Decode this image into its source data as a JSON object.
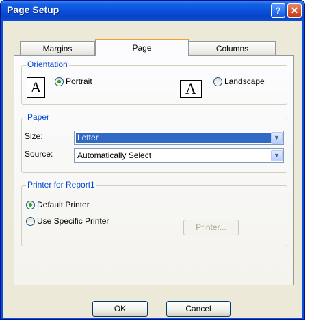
{
  "window": {
    "title": "Page Setup",
    "help_glyph": "?",
    "close_glyph": "✕"
  },
  "tabs": [
    {
      "label": "Margins",
      "active": false
    },
    {
      "label": "Page",
      "active": true
    },
    {
      "label": "Columns",
      "active": false
    }
  ],
  "orientation": {
    "title": "Orientation",
    "icon_glyph": "A",
    "portrait_label": "Portrait",
    "landscape_label": "Landscape",
    "selected": "Portrait"
  },
  "paper": {
    "title": "Paper",
    "size_label": "Size:",
    "size_value": "Letter",
    "source_label": "Source:",
    "source_value": "Automatically Select",
    "dropdown_glyph": "▼"
  },
  "printer": {
    "title": "Printer for Report1",
    "default_label": "Default Printer",
    "specific_label": "Use Specific Printer",
    "printer_button": "Printer...",
    "selected": "Default Printer"
  },
  "buttons": {
    "ok": "OK",
    "cancel": "Cancel"
  },
  "colors": {
    "title_bar": "#0a4fd8",
    "dialog_bg": "#ece9d8",
    "group_title": "#0046d5",
    "selection": "#316ac5",
    "active_tab_accent": "#f5a02b"
  }
}
